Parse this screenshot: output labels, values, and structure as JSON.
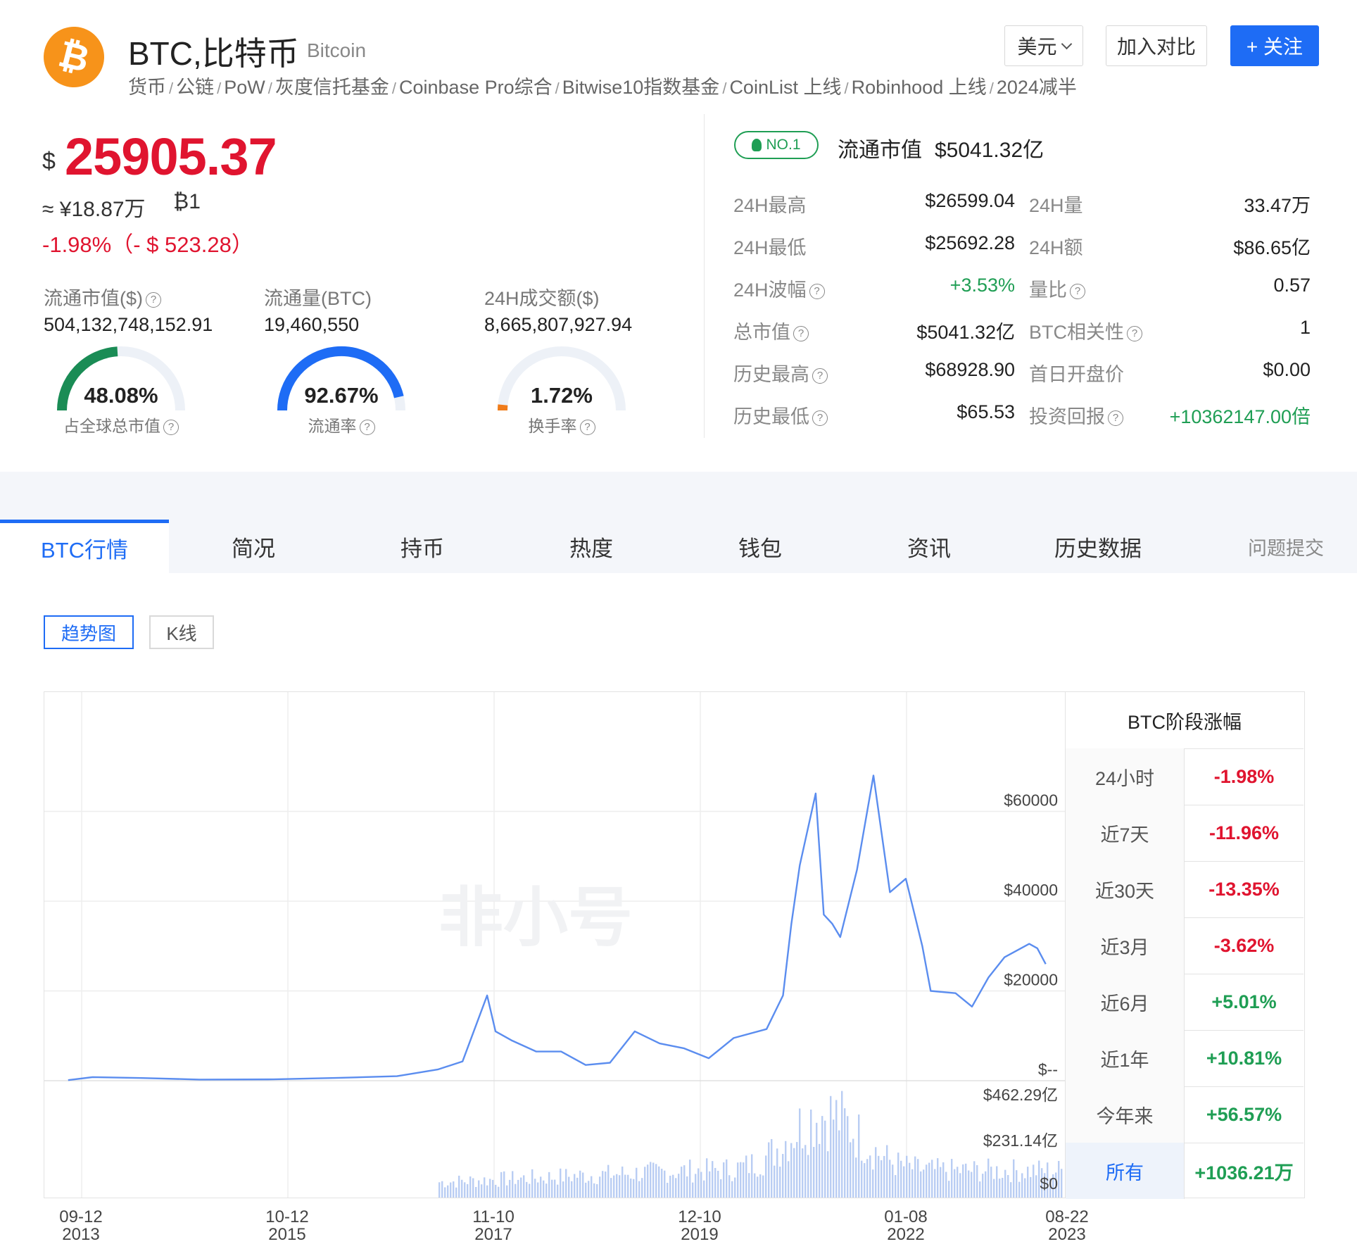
{
  "coin": {
    "symbol_glyph": "₿",
    "title": "BTC,比特币",
    "name_en": "Bitcoin",
    "tags": [
      "货币",
      "公链",
      "PoW",
      "灰度信托基金",
      "Coinbase Pro综合",
      "Bitwise10指数基金",
      "CoinList 上线",
      "Robinhood 上线",
      "2024减半"
    ]
  },
  "header_buttons": {
    "currency": "美元",
    "compare": "加入对比",
    "follow": "+ 关注"
  },
  "price": {
    "currency_symbol": "$",
    "value": "25905.37",
    "cny": "≈ ¥18.87万",
    "btc": "₿1",
    "change": "-1.98%（- $ 523.28）"
  },
  "stats": [
    {
      "label": "流通市值($)",
      "value": "504,132,748,152.91",
      "gauge_text": "48.08%",
      "gauge_pct": 48.08,
      "gauge_label": "占全球总市值",
      "color": "#1a8c55"
    },
    {
      "label": "流通量(BTC)",
      "value": "19,460,550",
      "gauge_text": "92.67%",
      "gauge_pct": 92.67,
      "gauge_label": "流通率",
      "color": "#1e6cf5"
    },
    {
      "label": "24H成交额($)",
      "value": "8,665,807,927.94",
      "gauge_text": "1.72%",
      "gauge_pct": 1.72,
      "gauge_label": "换手率",
      "color": "#f07c1a"
    }
  ],
  "rank_badge": "NO.1",
  "market_cap": {
    "label": "流通市值",
    "value": "$5041.32亿"
  },
  "right_stats": [
    {
      "l1": "24H最高",
      "v1": "$26599.04",
      "l2": "24H量",
      "v2": "33.47万"
    },
    {
      "l1": "24H最低",
      "v1": "$25692.28",
      "l2": "24H额",
      "v2": "$86.65亿"
    },
    {
      "l1": "24H波幅",
      "v1": "+3.53%",
      "l2": "量比",
      "v2": "0.57"
    },
    {
      "l1": "总市值",
      "v1": "$5041.32亿",
      "l2": "BTC相关性",
      "v2": "1"
    },
    {
      "l1": "历史最高",
      "v1": "$68928.90",
      "l2": "首日开盘价",
      "v2": "$0.00"
    },
    {
      "l1": "历史最低",
      "v1": "$65.53",
      "l2": "投资回报",
      "v2": "+10362147.00倍"
    }
  ],
  "tabs": [
    "BTC行情",
    "简况",
    "持币",
    "热度",
    "钱包",
    "资讯",
    "历史数据"
  ],
  "tab_report": "问题提交",
  "chart_switch": [
    "趋势图",
    "K线"
  ],
  "watermark": "非小号",
  "performance": {
    "title": "BTC阶段涨幅",
    "rows": [
      {
        "name": "24小时",
        "value": "-1.98%"
      },
      {
        "name": "近7天",
        "value": "-11.96%"
      },
      {
        "name": "近30天",
        "value": "-13.35%"
      },
      {
        "name": "近3月",
        "value": "-3.62%"
      },
      {
        "name": "近6月",
        "value": "+5.01%"
      },
      {
        "name": "近1年",
        "value": "+10.81%"
      },
      {
        "name": "今年来",
        "value": "+56.57%"
      },
      {
        "name": "所有",
        "value": "+1036.21万"
      }
    ]
  },
  "chart_data": {
    "type": "line",
    "x_ticks": [
      {
        "date": "09-12",
        "year": "2013"
      },
      {
        "date": "10-12",
        "year": "2015"
      },
      {
        "date": "11-10",
        "year": "2017"
      },
      {
        "date": "12-10",
        "year": "2019"
      },
      {
        "date": "01-08",
        "year": "2022"
      },
      {
        "date": "08-22",
        "year": "2023"
      }
    ],
    "price_ticks": [
      "$60000",
      "$40000",
      "$20000",
      "$--"
    ],
    "volume_ticks": [
      "$462.29亿",
      "$231.14亿",
      "$0"
    ],
    "price_ylim": [
      0,
      80000
    ],
    "volume_ylim": [
      0,
      462.29
    ],
    "price_series": {
      "x": [
        "2013-09",
        "2013-12",
        "2014-06",
        "2015-01",
        "2015-10",
        "2016-06",
        "2017-01",
        "2017-06",
        "2017-09",
        "2017-12",
        "2018-01",
        "2018-03",
        "2018-06",
        "2018-09",
        "2018-12",
        "2019-03",
        "2019-06",
        "2019-09",
        "2019-12",
        "2020-03",
        "2020-06",
        "2020-10",
        "2020-12",
        "2021-01",
        "2021-02",
        "2021-04",
        "2021-05",
        "2021-06",
        "2021-07",
        "2021-09",
        "2021-11",
        "2022-01",
        "2022-03",
        "2022-05",
        "2022-06",
        "2022-09",
        "2022-11",
        "2023-01",
        "2023-03",
        "2023-06",
        "2023-07",
        "2023-08"
      ],
      "y": [
        130,
        800,
        600,
        250,
        300,
        650,
        1000,
        2500,
        4300,
        19000,
        11000,
        9000,
        6500,
        6500,
        3500,
        4000,
        11000,
        8300,
        7200,
        5000,
        9500,
        11500,
        19000,
        35000,
        48000,
        64000,
        37000,
        35000,
        32000,
        47000,
        68000,
        42000,
        45000,
        30000,
        20000,
        19500,
        16500,
        23000,
        27500,
        30500,
        29500,
        26000
      ]
    },
    "volume_peak_date": "2021-05"
  }
}
